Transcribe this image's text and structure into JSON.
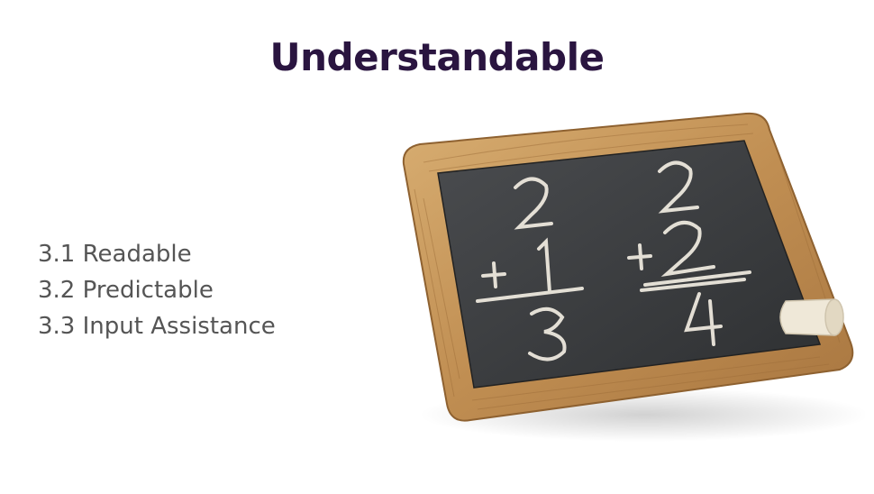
{
  "slide": {
    "title": "Understandable",
    "items": [
      "3.1 Readable",
      "3.2 Predictable",
      "3.3 Input Assistance"
    ]
  },
  "chalkboard": {
    "left_problem": {
      "top": "2",
      "addend": "1",
      "operator": "+",
      "result": "3"
    },
    "right_problem": {
      "top": "2",
      "addend": "2",
      "operator": "+",
      "result": "4"
    }
  },
  "colors": {
    "title": "#2a1540",
    "body_text": "#555555",
    "slate": "#3a3c3e",
    "frame": "#c79a5c",
    "chalk": "#f2ede2"
  }
}
